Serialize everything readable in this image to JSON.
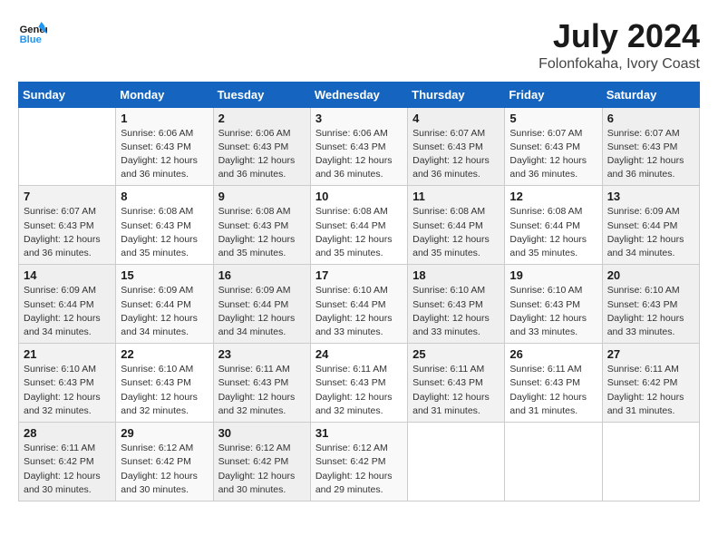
{
  "header": {
    "logo_general": "General",
    "logo_blue": "Blue",
    "month": "July 2024",
    "location": "Folonfokaha, Ivory Coast"
  },
  "weekdays": [
    "Sunday",
    "Monday",
    "Tuesday",
    "Wednesday",
    "Thursday",
    "Friday",
    "Saturday"
  ],
  "weeks": [
    [
      {
        "day": "",
        "sunrise": "",
        "sunset": "",
        "daylight": ""
      },
      {
        "day": "1",
        "sunrise": "Sunrise: 6:06 AM",
        "sunset": "Sunset: 6:43 PM",
        "daylight": "Daylight: 12 hours and 36 minutes."
      },
      {
        "day": "2",
        "sunrise": "Sunrise: 6:06 AM",
        "sunset": "Sunset: 6:43 PM",
        "daylight": "Daylight: 12 hours and 36 minutes."
      },
      {
        "day": "3",
        "sunrise": "Sunrise: 6:06 AM",
        "sunset": "Sunset: 6:43 PM",
        "daylight": "Daylight: 12 hours and 36 minutes."
      },
      {
        "day": "4",
        "sunrise": "Sunrise: 6:07 AM",
        "sunset": "Sunset: 6:43 PM",
        "daylight": "Daylight: 12 hours and 36 minutes."
      },
      {
        "day": "5",
        "sunrise": "Sunrise: 6:07 AM",
        "sunset": "Sunset: 6:43 PM",
        "daylight": "Daylight: 12 hours and 36 minutes."
      },
      {
        "day": "6",
        "sunrise": "Sunrise: 6:07 AM",
        "sunset": "Sunset: 6:43 PM",
        "daylight": "Daylight: 12 hours and 36 minutes."
      }
    ],
    [
      {
        "day": "7",
        "sunrise": "Sunrise: 6:07 AM",
        "sunset": "Sunset: 6:43 PM",
        "daylight": "Daylight: 12 hours and 36 minutes."
      },
      {
        "day": "8",
        "sunrise": "Sunrise: 6:08 AM",
        "sunset": "Sunset: 6:43 PM",
        "daylight": "Daylight: 12 hours and 35 minutes."
      },
      {
        "day": "9",
        "sunrise": "Sunrise: 6:08 AM",
        "sunset": "Sunset: 6:43 PM",
        "daylight": "Daylight: 12 hours and 35 minutes."
      },
      {
        "day": "10",
        "sunrise": "Sunrise: 6:08 AM",
        "sunset": "Sunset: 6:44 PM",
        "daylight": "Daylight: 12 hours and 35 minutes."
      },
      {
        "day": "11",
        "sunrise": "Sunrise: 6:08 AM",
        "sunset": "Sunset: 6:44 PM",
        "daylight": "Daylight: 12 hours and 35 minutes."
      },
      {
        "day": "12",
        "sunrise": "Sunrise: 6:08 AM",
        "sunset": "Sunset: 6:44 PM",
        "daylight": "Daylight: 12 hours and 35 minutes."
      },
      {
        "day": "13",
        "sunrise": "Sunrise: 6:09 AM",
        "sunset": "Sunset: 6:44 PM",
        "daylight": "Daylight: 12 hours and 34 minutes."
      }
    ],
    [
      {
        "day": "14",
        "sunrise": "Sunrise: 6:09 AM",
        "sunset": "Sunset: 6:44 PM",
        "daylight": "Daylight: 12 hours and 34 minutes."
      },
      {
        "day": "15",
        "sunrise": "Sunrise: 6:09 AM",
        "sunset": "Sunset: 6:44 PM",
        "daylight": "Daylight: 12 hours and 34 minutes."
      },
      {
        "day": "16",
        "sunrise": "Sunrise: 6:09 AM",
        "sunset": "Sunset: 6:44 PM",
        "daylight": "Daylight: 12 hours and 34 minutes."
      },
      {
        "day": "17",
        "sunrise": "Sunrise: 6:10 AM",
        "sunset": "Sunset: 6:44 PM",
        "daylight": "Daylight: 12 hours and 33 minutes."
      },
      {
        "day": "18",
        "sunrise": "Sunrise: 6:10 AM",
        "sunset": "Sunset: 6:43 PM",
        "daylight": "Daylight: 12 hours and 33 minutes."
      },
      {
        "day": "19",
        "sunrise": "Sunrise: 6:10 AM",
        "sunset": "Sunset: 6:43 PM",
        "daylight": "Daylight: 12 hours and 33 minutes."
      },
      {
        "day": "20",
        "sunrise": "Sunrise: 6:10 AM",
        "sunset": "Sunset: 6:43 PM",
        "daylight": "Daylight: 12 hours and 33 minutes."
      }
    ],
    [
      {
        "day": "21",
        "sunrise": "Sunrise: 6:10 AM",
        "sunset": "Sunset: 6:43 PM",
        "daylight": "Daylight: 12 hours and 32 minutes."
      },
      {
        "day": "22",
        "sunrise": "Sunrise: 6:10 AM",
        "sunset": "Sunset: 6:43 PM",
        "daylight": "Daylight: 12 hours and 32 minutes."
      },
      {
        "day": "23",
        "sunrise": "Sunrise: 6:11 AM",
        "sunset": "Sunset: 6:43 PM",
        "daylight": "Daylight: 12 hours and 32 minutes."
      },
      {
        "day": "24",
        "sunrise": "Sunrise: 6:11 AM",
        "sunset": "Sunset: 6:43 PM",
        "daylight": "Daylight: 12 hours and 32 minutes."
      },
      {
        "day": "25",
        "sunrise": "Sunrise: 6:11 AM",
        "sunset": "Sunset: 6:43 PM",
        "daylight": "Daylight: 12 hours and 31 minutes."
      },
      {
        "day": "26",
        "sunrise": "Sunrise: 6:11 AM",
        "sunset": "Sunset: 6:43 PM",
        "daylight": "Daylight: 12 hours and 31 minutes."
      },
      {
        "day": "27",
        "sunrise": "Sunrise: 6:11 AM",
        "sunset": "Sunset: 6:42 PM",
        "daylight": "Daylight: 12 hours and 31 minutes."
      }
    ],
    [
      {
        "day": "28",
        "sunrise": "Sunrise: 6:11 AM",
        "sunset": "Sunset: 6:42 PM",
        "daylight": "Daylight: 12 hours and 30 minutes."
      },
      {
        "day": "29",
        "sunrise": "Sunrise: 6:12 AM",
        "sunset": "Sunset: 6:42 PM",
        "daylight": "Daylight: 12 hours and 30 minutes."
      },
      {
        "day": "30",
        "sunrise": "Sunrise: 6:12 AM",
        "sunset": "Sunset: 6:42 PM",
        "daylight": "Daylight: 12 hours and 30 minutes."
      },
      {
        "day": "31",
        "sunrise": "Sunrise: 6:12 AM",
        "sunset": "Sunset: 6:42 PM",
        "daylight": "Daylight: 12 hours and 29 minutes."
      },
      {
        "day": "",
        "sunrise": "",
        "sunset": "",
        "daylight": ""
      },
      {
        "day": "",
        "sunrise": "",
        "sunset": "",
        "daylight": ""
      },
      {
        "day": "",
        "sunrise": "",
        "sunset": "",
        "daylight": ""
      }
    ]
  ]
}
